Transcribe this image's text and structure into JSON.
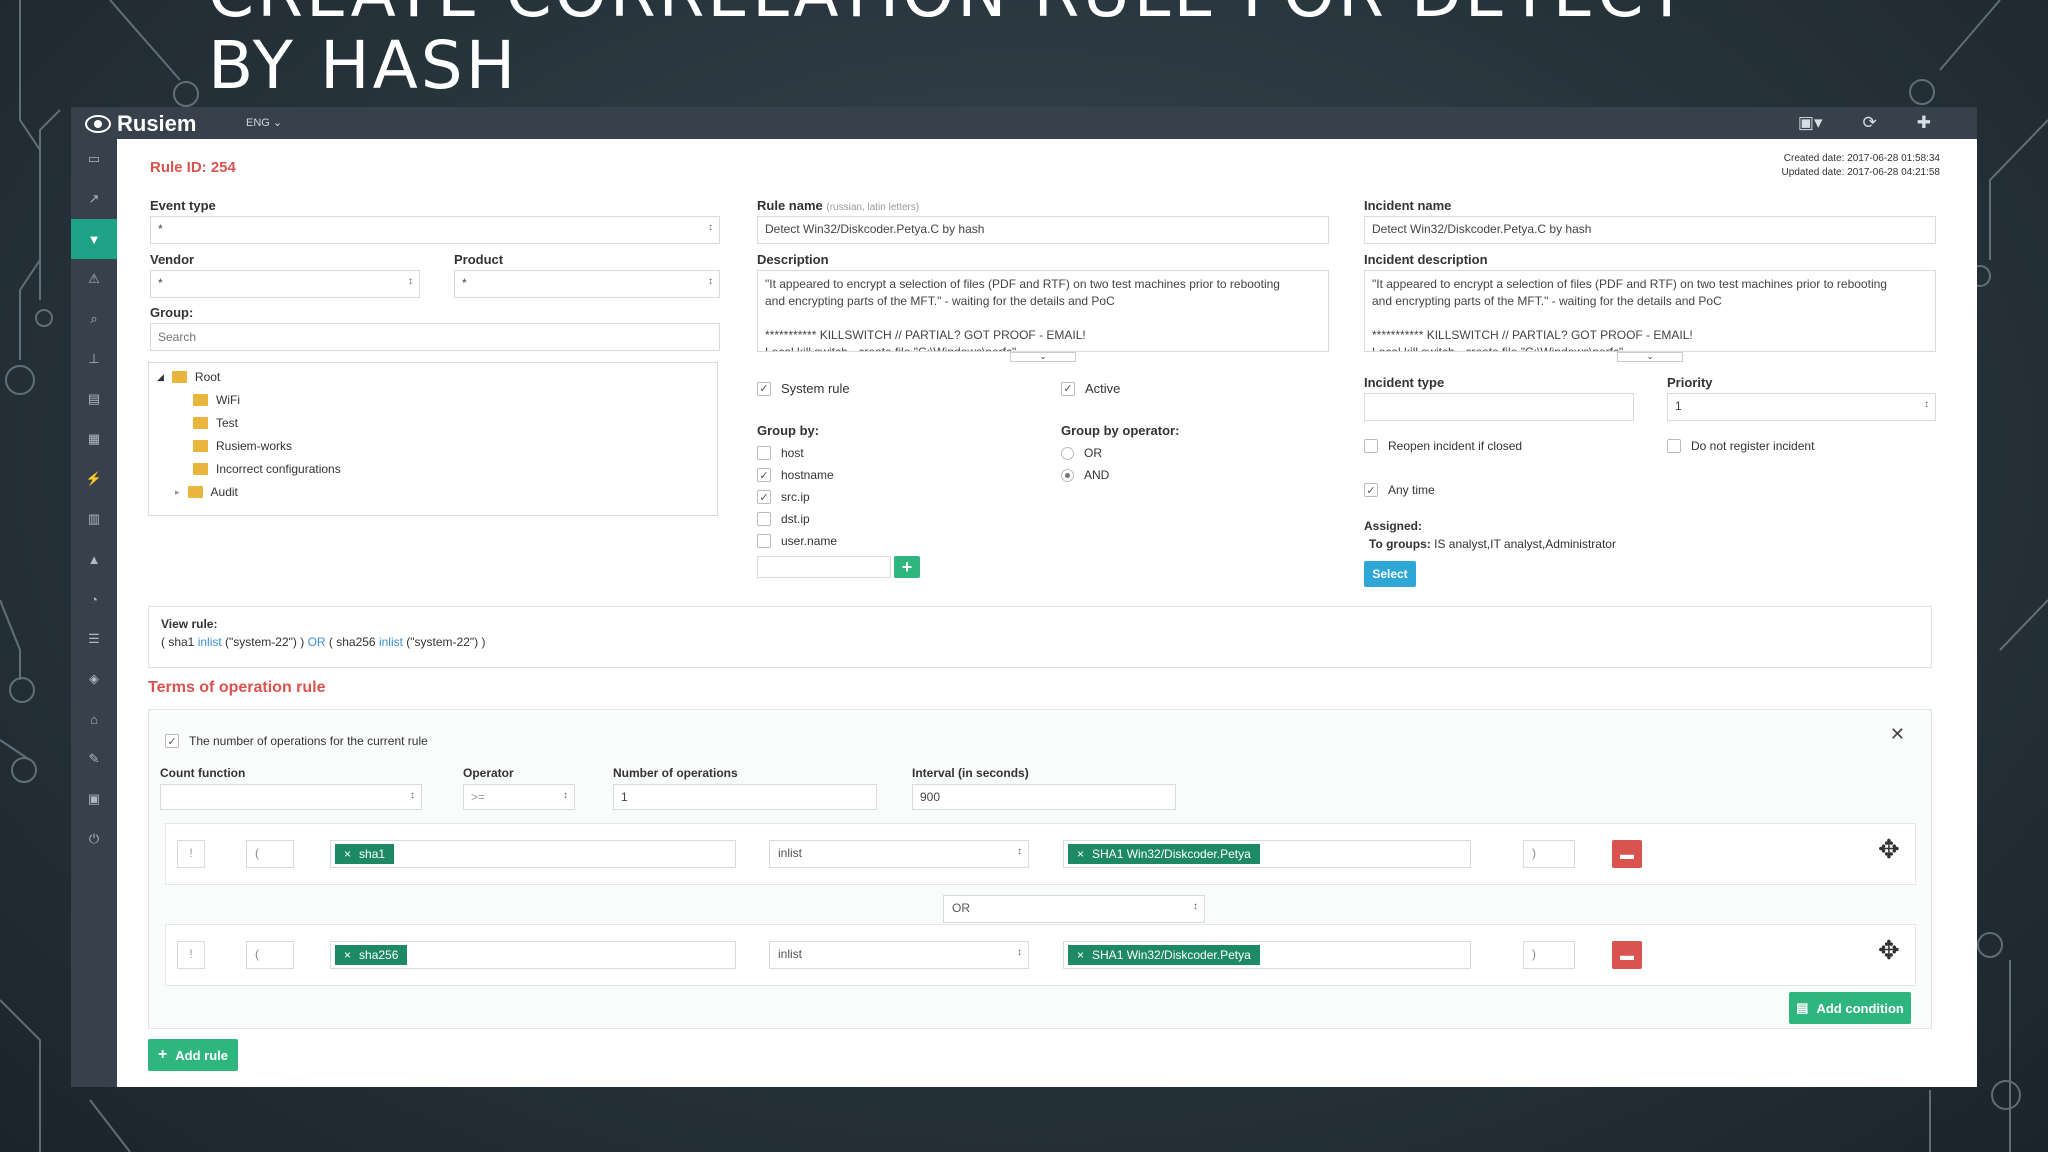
{
  "slide": {
    "title_line1": "CREATE CORRELATION RULE FOR DETECT",
    "title_line2": "BY HASH"
  },
  "app": {
    "brand": "Rusiem",
    "lang": "ENG"
  },
  "header": {
    "rule_id": "Rule ID: 254",
    "created": "Created date: 2017-06-28 01:58:34",
    "updated": "Updated date: 2017-06-28 04:21:58"
  },
  "left": {
    "event_type_label": "Event type",
    "event_type_value": "*",
    "vendor_label": "Vendor",
    "vendor_value": "*",
    "product_label": "Product",
    "product_value": "*",
    "group_label": "Group:",
    "search_placeholder": "Search",
    "tree": [
      "Root",
      "WiFi",
      "Test",
      "Rusiem-works",
      "Incorrect configurations",
      "Audit"
    ]
  },
  "middle": {
    "rule_name_label": "Rule name",
    "rule_name_hint": "(russian, latin letters)",
    "rule_name_value": "Detect Win32/Diskcoder.Petya.C by hash",
    "description_label": "Description",
    "description_lines": [
      "\"It appeared to encrypt a selection of files (PDF and RTF) on two test machines prior to rebooting",
      "and encrypting parts of the MFT.\" - waiting for the details and PoC",
      "",
      "*********** KILLSWITCH // PARTIAL? GOT PROOF - EMAIL!",
      "Local kill switch - create file \"C:\\Windows\\perfc\""
    ],
    "system_rule": "System rule",
    "active": "Active",
    "group_by_label": "Group by:",
    "group_by": [
      "host",
      "hostname",
      "src.ip",
      "dst.ip",
      "user.name"
    ],
    "group_by_operator_label": "Group by operator:",
    "operators": [
      "OR",
      "AND"
    ]
  },
  "right": {
    "incident_name_label": "Incident name",
    "incident_name_value": "Detect Win32/Diskcoder.Petya.C by hash",
    "incident_desc_label": "Incident description",
    "incident_type_label": "Incident type",
    "priority_label": "Priority",
    "priority_value": "1",
    "reopen": "Reopen incident if closed",
    "not_register": "Do not register incident",
    "any_time": "Any time",
    "assigned_label": "Assigned:",
    "to_groups_label": "To groups:",
    "to_groups_value": "IS analyst,IT analyst,Administrator",
    "select_button": "Select"
  },
  "view_rule": {
    "label": "View rule:",
    "p1": "( sha1 ",
    "k1": "inlist",
    "p2": " (\"system-22\") ) ",
    "k2": "OR",
    "p3": " ( sha256 ",
    "k3": "inlist",
    "p4": " (\"system-22\") )"
  },
  "terms": {
    "title": "Terms of operation rule",
    "count_checkbox": "The number of operations for the current rule",
    "count_function_label": "Count function",
    "operator_label": "Operator",
    "operator_value": ">=",
    "num_ops_label": "Number of operations",
    "num_ops_value": "1",
    "interval_label": "Interval (in seconds)",
    "interval_value": "900",
    "conditions": [
      {
        "not": "!",
        "open": "(",
        "field": "sha1",
        "op": "inlist",
        "value": "SHA1 Win32/Diskcoder.Petya",
        "close": ")"
      },
      {
        "not": "!",
        "open": "(",
        "field": "sha256",
        "op": "inlist",
        "value": "SHA1 Win32/Diskcoder.Petya",
        "close": ")"
      }
    ],
    "joiner": "OR",
    "add_condition": "Add condition",
    "add_rule": "Add rule"
  },
  "colors": {
    "accent": "#1fa287",
    "danger": "#d9534f",
    "tag": "#1e8a65",
    "button": "#2fb57e",
    "select": "#2ea6d6"
  }
}
